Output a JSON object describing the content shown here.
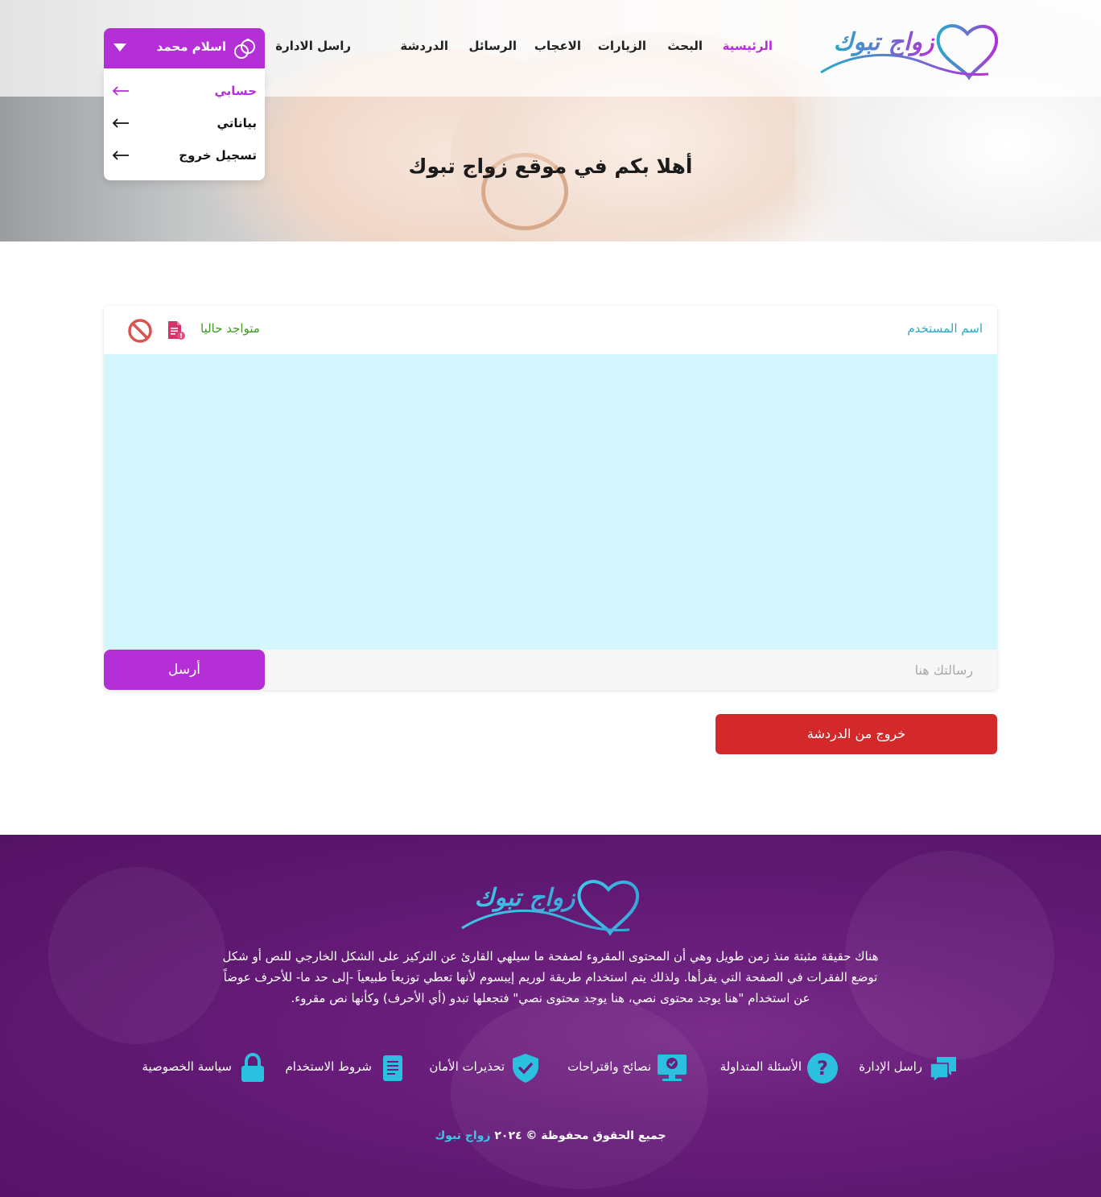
{
  "site": {
    "logo_text": "زواج تبوك"
  },
  "nav": {
    "items": [
      "الرئيسية",
      "البحث",
      "الزيارات",
      "الاعجاب",
      "الرسائل",
      "الدردشة",
      "راسل الادارة"
    ],
    "active_index": 0,
    "accent_color": "#b52fd6"
  },
  "hero": {
    "title": "أهلا بكم في موقع زواج تبوك"
  },
  "user_menu": {
    "name": "اسلام محمد",
    "items": [
      "حسابي",
      "بياناتي",
      "تسجيل خروج"
    ],
    "active_index": 0
  },
  "chat": {
    "username": "اسم المستخدم",
    "status": "متواجد حاليا",
    "status_color": "#3f9b22",
    "input_placeholder": "رسالتك هنا",
    "send_label": "أرسل",
    "leave_label": "خروج من  الدردشة",
    "body_color": "#d4f6fd"
  },
  "footer": {
    "description": "هناك حقيقة مثبتة منذ زمن طويل وهي أن المحتوى المقروء لصفحة ما سيلهي القارئ عن التركيز على الشكل الخارجي للنص أو شكل توضع الفقرات في الصفحة التي يقرأها. ولذلك يتم استخدام طريقة لوريم إيبسوم لأنها تعطي توزيعاَ طبيعياَ -إلى حد ما- للأحرف عوضاً عن استخدام \"هنا يوجد محتوى نصي، هنا يوجد محتوى نصي\" فتجعلها تبدو (أي الأحرف) وكأنها نص مقروء.",
    "links": [
      {
        "label": "راسل الإدارة",
        "icon": "chat-bubbles-icon"
      },
      {
        "label": "الأسئلة المتداولة",
        "icon": "question-icon"
      },
      {
        "label": "نصائح واقتراحات",
        "icon": "monitor-check-icon"
      },
      {
        "label": "تحذيرات الأمان",
        "icon": "shield-check-icon"
      },
      {
        "label": "شروط الاستخدام",
        "icon": "document-icon"
      },
      {
        "label": "سياسة الخصوصية",
        "icon": "lock-icon"
      }
    ],
    "icon_color": "#2cc0e0",
    "copyright_prefix": "جميع الحقوق محفوظة © ٢٠٢٤",
    "copyright_brand": "زواج تبوك"
  }
}
